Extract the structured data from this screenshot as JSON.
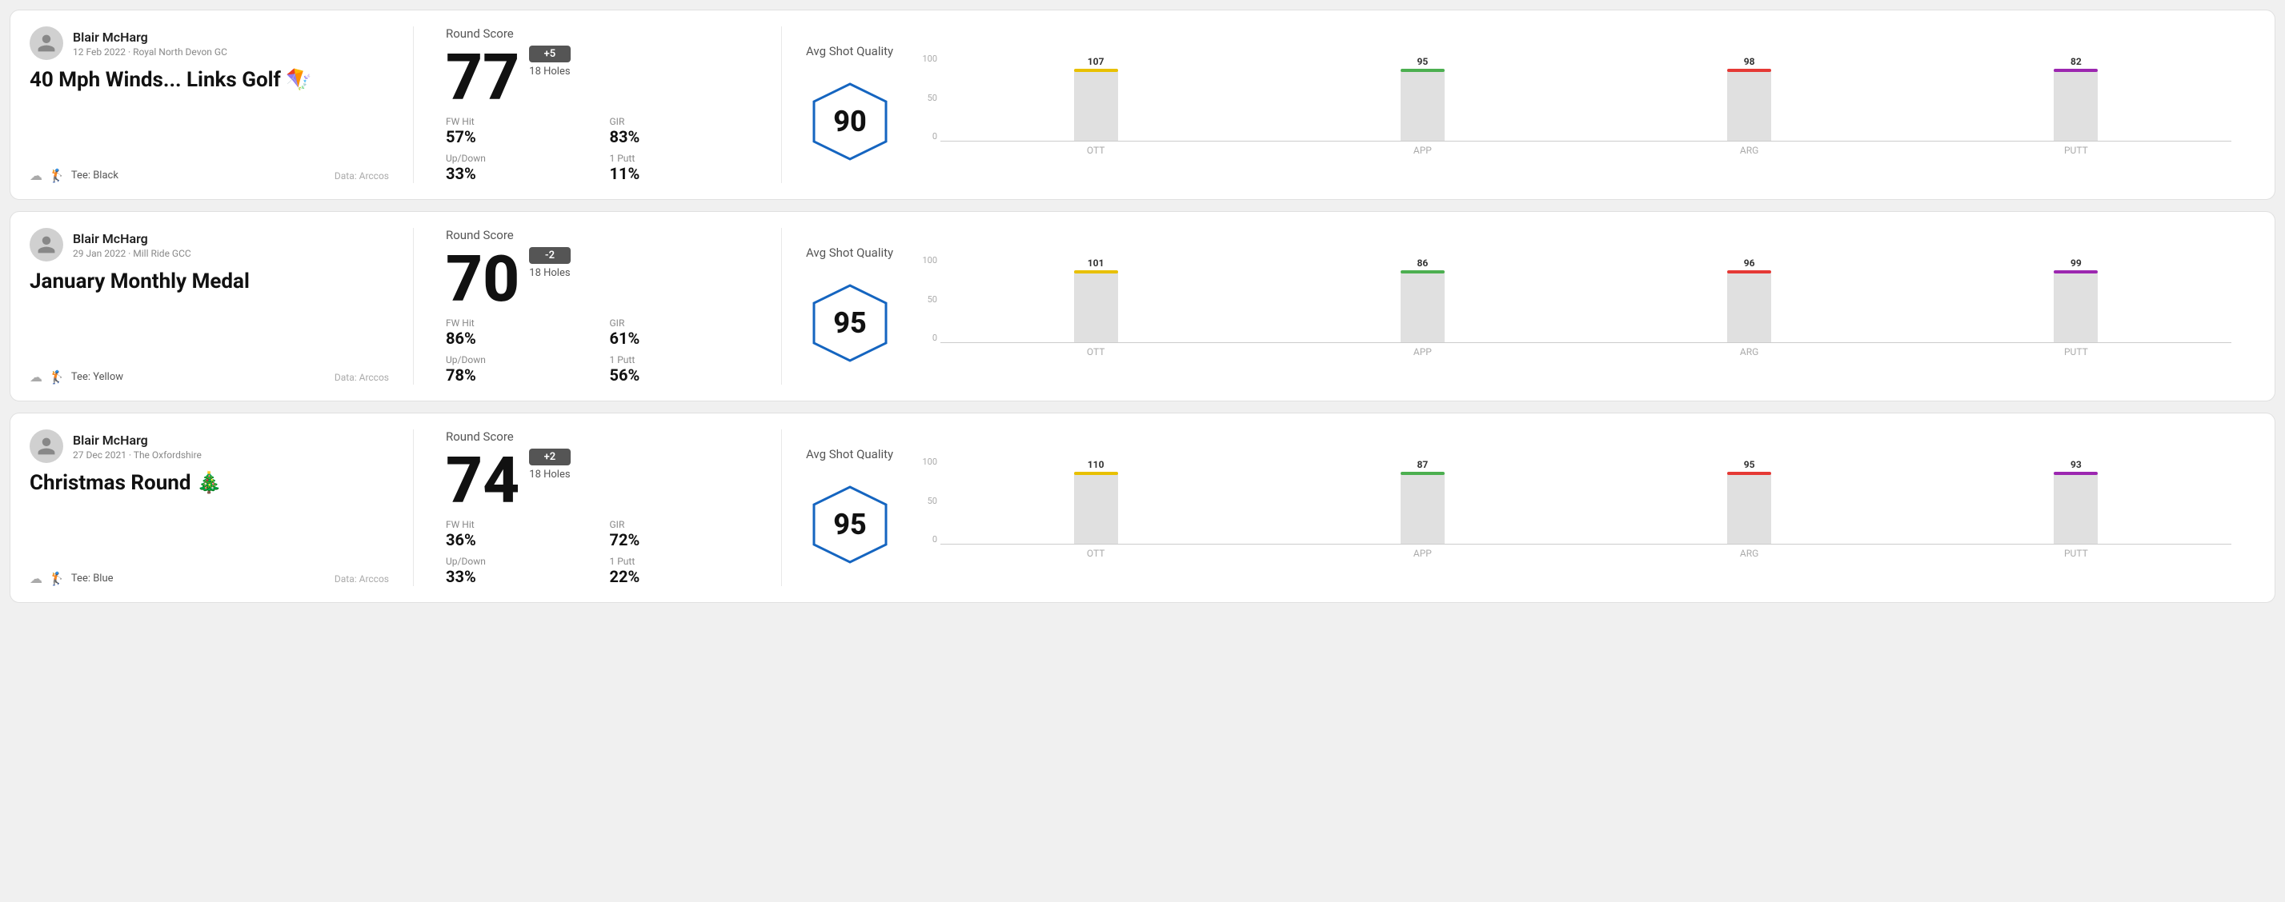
{
  "rounds": [
    {
      "id": "round1",
      "user": {
        "name": "Blair McHarg",
        "date": "12 Feb 2022",
        "course": "Royal North Devon GC"
      },
      "title": "40 Mph Winds... Links Golf",
      "title_emoji": "🪁",
      "tee": "Black",
      "data_source": "Data: Arccos",
      "round_score_label": "Round Score",
      "score": "77",
      "score_diff": "+5",
      "holes": "18 Holes",
      "fw_hit_label": "FW Hit",
      "fw_hit_value": "57%",
      "gir_label": "GIR",
      "gir_value": "83%",
      "updown_label": "Up/Down",
      "updown_value": "33%",
      "one_putt_label": "1 Putt",
      "one_putt_value": "11%",
      "avg_shot_quality_label": "Avg Shot Quality",
      "avg_shot_quality": "90",
      "chart": {
        "bars": [
          {
            "label": "OTT",
            "value": 107,
            "color": "#e8c000",
            "bar_pct": 72
          },
          {
            "label": "APP",
            "value": 95,
            "color": "#4caf50",
            "bar_pct": 55
          },
          {
            "label": "ARG",
            "value": 98,
            "color": "#e53935",
            "bar_pct": 60
          },
          {
            "label": "PUTT",
            "value": 82,
            "color": "#9c27b0",
            "bar_pct": 42
          }
        ],
        "y_labels": [
          "100",
          "50",
          "0"
        ]
      }
    },
    {
      "id": "round2",
      "user": {
        "name": "Blair McHarg",
        "date": "29 Jan 2022",
        "course": "Mill Ride GCC"
      },
      "title": "January Monthly Medal",
      "title_emoji": "",
      "tee": "Yellow",
      "data_source": "Data: Arccos",
      "round_score_label": "Round Score",
      "score": "70",
      "score_diff": "-2",
      "holes": "18 Holes",
      "fw_hit_label": "FW Hit",
      "fw_hit_value": "86%",
      "gir_label": "GIR",
      "gir_value": "61%",
      "updown_label": "Up/Down",
      "updown_value": "78%",
      "one_putt_label": "1 Putt",
      "one_putt_value": "56%",
      "avg_shot_quality_label": "Avg Shot Quality",
      "avg_shot_quality": "95",
      "chart": {
        "bars": [
          {
            "label": "OTT",
            "value": 101,
            "color": "#e8c000",
            "bar_pct": 68
          },
          {
            "label": "APP",
            "value": 86,
            "color": "#4caf50",
            "bar_pct": 48
          },
          {
            "label": "ARG",
            "value": 96,
            "color": "#e53935",
            "bar_pct": 58
          },
          {
            "label": "PUTT",
            "value": 99,
            "color": "#9c27b0",
            "bar_pct": 62
          }
        ],
        "y_labels": [
          "100",
          "50",
          "0"
        ]
      }
    },
    {
      "id": "round3",
      "user": {
        "name": "Blair McHarg",
        "date": "27 Dec 2021",
        "course": "The Oxfordshire"
      },
      "title": "Christmas Round",
      "title_emoji": "🎄",
      "tee": "Blue",
      "data_source": "Data: Arccos",
      "round_score_label": "Round Score",
      "score": "74",
      "score_diff": "+2",
      "holes": "18 Holes",
      "fw_hit_label": "FW Hit",
      "fw_hit_value": "36%",
      "gir_label": "GIR",
      "gir_value": "72%",
      "updown_label": "Up/Down",
      "updown_value": "33%",
      "one_putt_label": "1 Putt",
      "one_putt_value": "22%",
      "avg_shot_quality_label": "Avg Shot Quality",
      "avg_shot_quality": "95",
      "chart": {
        "bars": [
          {
            "label": "OTT",
            "value": 110,
            "color": "#e8c000",
            "bar_pct": 76
          },
          {
            "label": "APP",
            "value": 87,
            "color": "#4caf50",
            "bar_pct": 50
          },
          {
            "label": "ARG",
            "value": 95,
            "color": "#e53935",
            "bar_pct": 57
          },
          {
            "label": "PUTT",
            "value": 93,
            "color": "#9c27b0",
            "bar_pct": 56
          }
        ],
        "y_labels": [
          "100",
          "50",
          "0"
        ]
      }
    }
  ],
  "hexagon_stroke": "#1565c0"
}
